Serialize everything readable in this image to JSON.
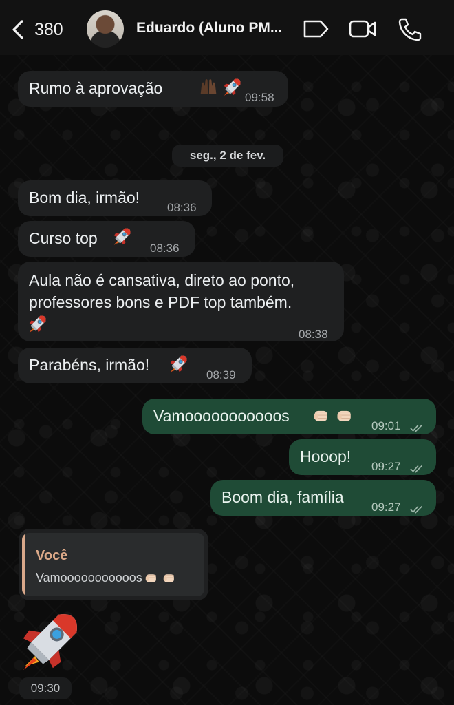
{
  "header": {
    "back_count": "380",
    "contact_name": "Eduardo (Aluno PM...",
    "icons": [
      "chevron-left-icon",
      "tag-icon",
      "video-camera-icon",
      "phone-icon"
    ]
  },
  "date_divider": "seg., 2 de fev.",
  "messages": [
    {
      "text": "Rumo à aprovação",
      "time": "09:58",
      "direction": "in"
    },
    {
      "text": "Bom dia, irmão!",
      "time": "08:36",
      "direction": "in"
    },
    {
      "text": "Curso top",
      "time": "08:36",
      "direction": "in"
    },
    {
      "line1": "Aula não é cansativa, direto ao ponto,",
      "line2": "professores bons e PDF top também.",
      "time": "08:38",
      "direction": "in"
    },
    {
      "text": "Parabéns, irmão!",
      "time": "08:39",
      "direction": "in"
    },
    {
      "text": "Vamooooooooooos",
      "time": "09:01",
      "direction": "out"
    },
    {
      "text": "Hooop!",
      "time": "09:27",
      "direction": "out"
    },
    {
      "text": "Boom dia, família",
      "time": "09:27",
      "direction": "out"
    }
  ],
  "reply": {
    "quoted_author": "Você",
    "quoted_text": "Vamooooooooooos",
    "time": "09:30"
  },
  "colors": {
    "incoming_bubble": "#1f2021",
    "outgoing_bubble": "#1f4b36",
    "quote_accent": "#d9a88a",
    "header_bg": "#121212"
  }
}
